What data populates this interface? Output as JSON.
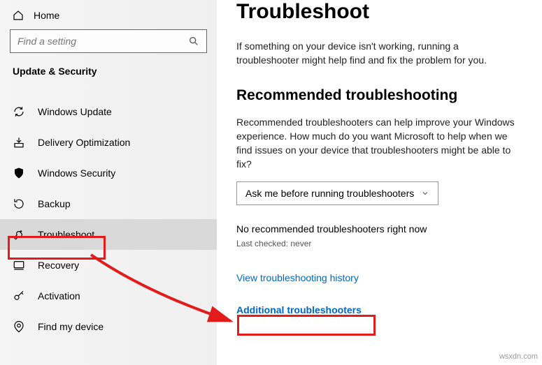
{
  "sidebar": {
    "home_label": "Home",
    "search_placeholder": "Find a setting",
    "section_title": "Update & Security",
    "items": [
      {
        "label": "Windows Update"
      },
      {
        "label": "Delivery Optimization"
      },
      {
        "label": "Windows Security"
      },
      {
        "label": "Backup"
      },
      {
        "label": "Troubleshoot"
      },
      {
        "label": "Recovery"
      },
      {
        "label": "Activation"
      },
      {
        "label": "Find my device"
      }
    ]
  },
  "main": {
    "title": "Troubleshoot",
    "intro": "If something on your device isn't working, running a troubleshooter might help find and fix the problem for you.",
    "recommended_title": "Recommended troubleshooting",
    "recommended_body": "Recommended troubleshooters can help improve your Windows experience. How much do you want Microsoft to help when we find issues on your device that troubleshooters might be able to fix?",
    "dropdown_value": "Ask me before running troubleshooters",
    "status_text": "No recommended troubleshooters right now",
    "last_checked": "Last checked: never",
    "history_link": "View troubleshooting history",
    "additional_link": "Additional troubleshooters"
  },
  "watermark": "wsxdn.com"
}
